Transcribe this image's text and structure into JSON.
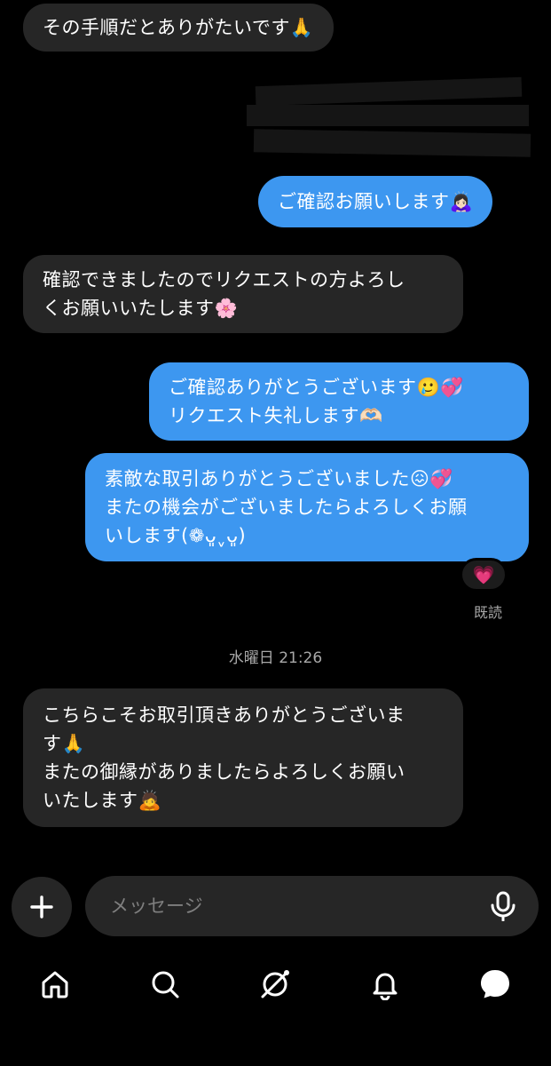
{
  "messages": [
    {
      "text": "その手順だとありがたいです🙏"
    },
    {
      "text": "ご確認お願いします🙇🏻‍♀️"
    },
    {
      "text": "確認できましたのでリクエストの方よろし\nくお願いいたします🌸"
    },
    {
      "text": "ご確認ありがとうございます🥲💞\nリクエスト失礼します🫶🏻"
    },
    {
      "text": "素敵な取引ありがとうございました😖💞\nまたの機会がございましたらよろしくお願\nいします(❁ᴗ͈ˬᴗ͈)"
    },
    {
      "text": "こちらこそお取引頂きありがとうございま\nす🙏\nまたの御縁がありましたらよろしくお願い\nいたします🙇"
    }
  ],
  "reaction": "💗",
  "seen_label": "既読",
  "timestamp": "水曜日 21:26",
  "composer": {
    "placeholder": "メッセージ"
  },
  "nav": {
    "items": [
      "home-icon",
      "search-icon",
      "explore-icon",
      "notifications-icon",
      "messages-icon"
    ]
  },
  "colors": {
    "incoming": "#262626",
    "outgoing": "#3d97f0",
    "background": "#000000"
  }
}
